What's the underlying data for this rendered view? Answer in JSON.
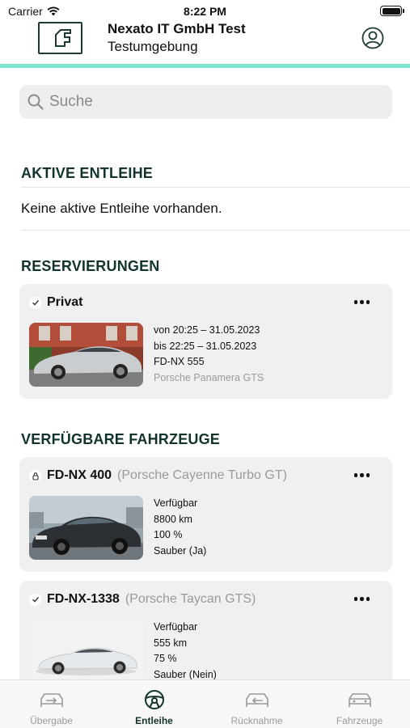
{
  "status_bar": {
    "carrier": "Carrier",
    "time": "8:22 PM"
  },
  "header": {
    "title": "Nexato IT GmbH Test",
    "subtitle": "Testumgebung"
  },
  "colors": {
    "accent": "#7fe4cf",
    "brand_dark": "#12332e",
    "card_bg": "#f0f0f0",
    "muted": "#9a9a9a"
  },
  "search": {
    "placeholder": "Suche",
    "value": ""
  },
  "active_loans": {
    "title": "AKTIVE ENTLEIHE",
    "empty_text": "Keine aktive Entleihe vorhanden."
  },
  "reservations": {
    "title": "RESERVIERUNGEN",
    "items": [
      {
        "label": "Privat",
        "from": "von 20:25 – 31.05.2023",
        "to": "bis 22:25 – 31.05.2023",
        "plate": "FD-NX 555",
        "model": "Porsche Panamera GTS"
      }
    ]
  },
  "available_vehicles": {
    "title": "VERFÜGBARE FAHRZEUGE",
    "items": [
      {
        "plate": "FD-NX 400",
        "model": "(Porsche Cayenne Turbo GT)",
        "status": "Verfügbar",
        "mileage": "8800 km",
        "charge": "100 %",
        "clean": "Sauber (Ja)",
        "icon": "lock-icon"
      },
      {
        "plate": "FD-NX-1338",
        "model": "(Porsche Taycan GTS)",
        "status": "Verfügbar",
        "mileage": "555 km",
        "charge": "75 %",
        "clean": "Sauber (Nein)",
        "icon": "checkmark-icon"
      }
    ]
  },
  "tabs": [
    {
      "label": "Übergabe",
      "icon": "car-handover-icon",
      "active": false
    },
    {
      "label": "Entleihe",
      "icon": "steering-wheel-icon",
      "active": true
    },
    {
      "label": "Rücknahme",
      "icon": "car-return-icon",
      "active": false
    },
    {
      "label": "Fahrzeuge",
      "icon": "car-icon",
      "active": false
    }
  ]
}
